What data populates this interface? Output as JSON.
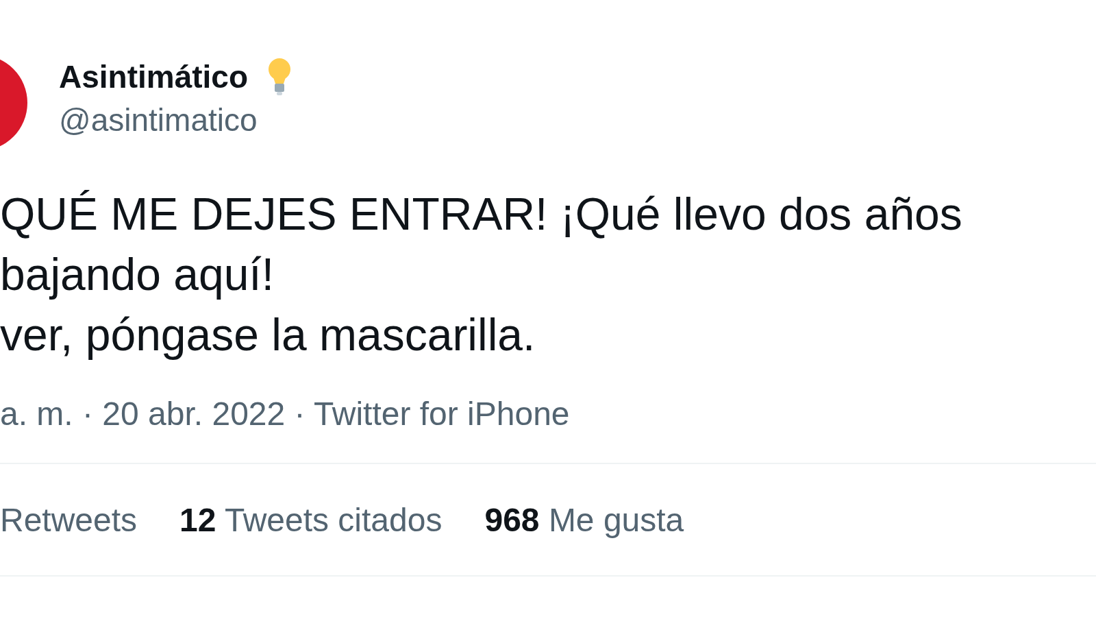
{
  "author": {
    "name": "Asintimático",
    "handle": "@asintimatico"
  },
  "tweet": {
    "lines": [
      "QUÉ ME DEJES ENTRAR! ¡Qué llevo dos años",
      "bajando aquí!",
      "ver, póngase la mascarilla."
    ]
  },
  "meta": "a. m. · 20 abr. 2022 · Twitter for iPhone",
  "stats": [
    {
      "label": "Retweets"
    },
    {
      "count": "12",
      "label": "Tweets citados"
    },
    {
      "count": "968",
      "label": "Me gusta"
    }
  ]
}
